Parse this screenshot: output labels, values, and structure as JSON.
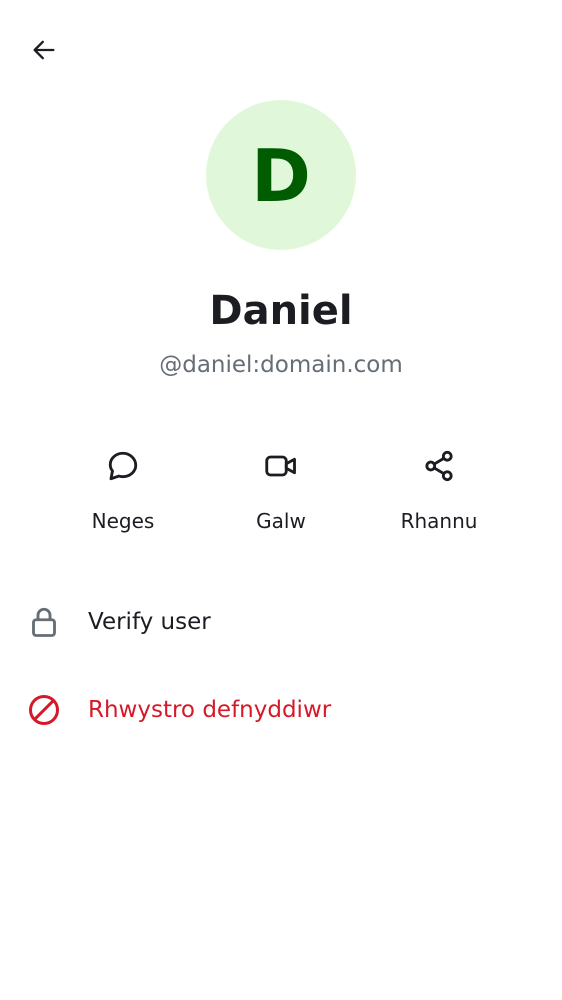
{
  "header": {
    "back_icon": "arrow-left-icon"
  },
  "profile": {
    "avatar_letter": "D",
    "avatar_bg": "#e0f8d9",
    "avatar_fg": "#005c00",
    "name": "Daniel",
    "user_id": "@daniel:domain.com"
  },
  "actions": [
    {
      "label": "Neges",
      "icon": "chat-bubble-icon"
    },
    {
      "label": "Galw",
      "icon": "video-call-icon"
    },
    {
      "label": "Rhannu",
      "icon": "share-icon"
    }
  ],
  "menu": {
    "verify_label": "Verify user",
    "verify_icon": "lock-icon",
    "block_label": "Rhwystro defnyddiwr",
    "block_icon": "block-icon",
    "danger_color": "#d51928"
  }
}
